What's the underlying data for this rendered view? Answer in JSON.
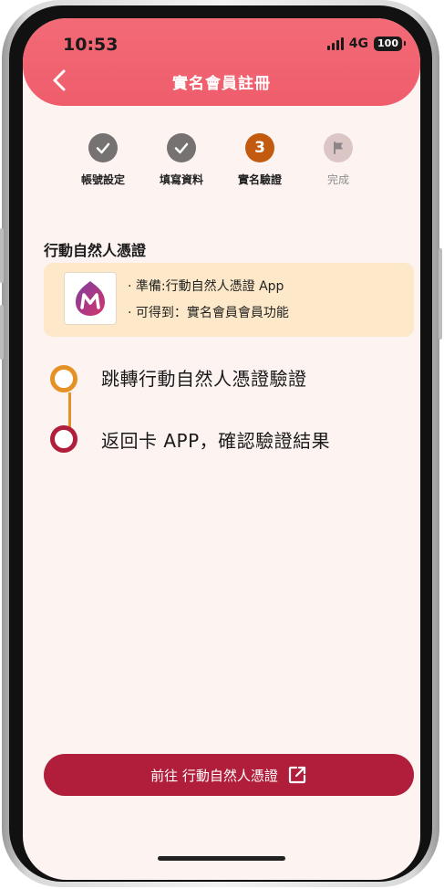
{
  "status_bar": {
    "time": "10:53",
    "network": "4G",
    "battery": "100"
  },
  "header": {
    "title": "實名會員註冊"
  },
  "steps": [
    {
      "label": "帳號設定",
      "state": "done",
      "symbol": ""
    },
    {
      "label": "填寫資料",
      "state": "done",
      "symbol": ""
    },
    {
      "label": "實名驗證",
      "state": "current",
      "symbol": "3"
    },
    {
      "label": "完成",
      "state": "todo",
      "symbol": ""
    }
  ],
  "section": {
    "title": "行動自然人憑證"
  },
  "info_card": {
    "logo_icon": "moica-app-logo",
    "line1": "· 準備:行動自然人憑證 App",
    "line2": "· 可得到：實名會員會員功能"
  },
  "flow": [
    {
      "text": "跳轉行動自然人憑證驗證",
      "color": "#e69126"
    },
    {
      "text": "返回卡 APP，確認驗證結果",
      "color": "#b01e3b"
    }
  ],
  "cta": {
    "label": "前往 行動自然人憑證",
    "icon": "external-link-icon"
  },
  "colors": {
    "header": "#f0616f",
    "background": "#fdf3f1",
    "done": "#767272",
    "current": "#c25a10",
    "todo": "#d9c3c2",
    "card": "#fde9c9",
    "cta": "#b01e3b"
  }
}
